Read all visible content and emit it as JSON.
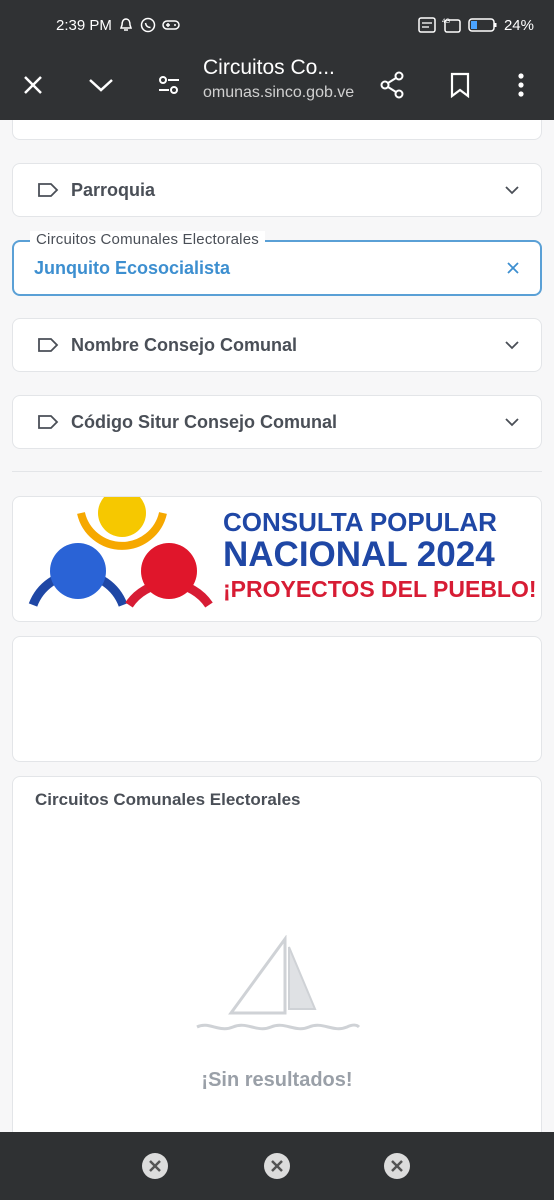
{
  "status_bar": {
    "time": "2:39 PM",
    "battery": "24%"
  },
  "browser": {
    "page_title": "Circuitos Co...",
    "url": "omunas.sinco.gob.ve",
    "icons": [
      "close-icon",
      "chevron-down-icon",
      "tune-icon",
      "share-icon",
      "bookmark-icon",
      "more-vert-icon"
    ]
  },
  "filters": {
    "parroquia_label": "Parroquia",
    "circuito": {
      "label": "Circuitos Comunales Electorales",
      "value": "Junquito Ecosocialista"
    },
    "consejo_label": "Nombre Consejo Comunal",
    "codigo_label": "Código Situr Consejo Comunal"
  },
  "banner": {
    "line1": "CONSULTA POPULAR",
    "line2": "NACIONAL 2024",
    "line3": "¡PROYECTOS DEL PUEBLO!",
    "colors": {
      "blue": "#1f47a5",
      "red": "#d71c34",
      "yellow": "#f6c800"
    }
  },
  "results": {
    "title": "Circuitos Comunales Electorales",
    "empty_message": "¡Sin resultados!"
  },
  "accent_color": "#3d8fd0"
}
